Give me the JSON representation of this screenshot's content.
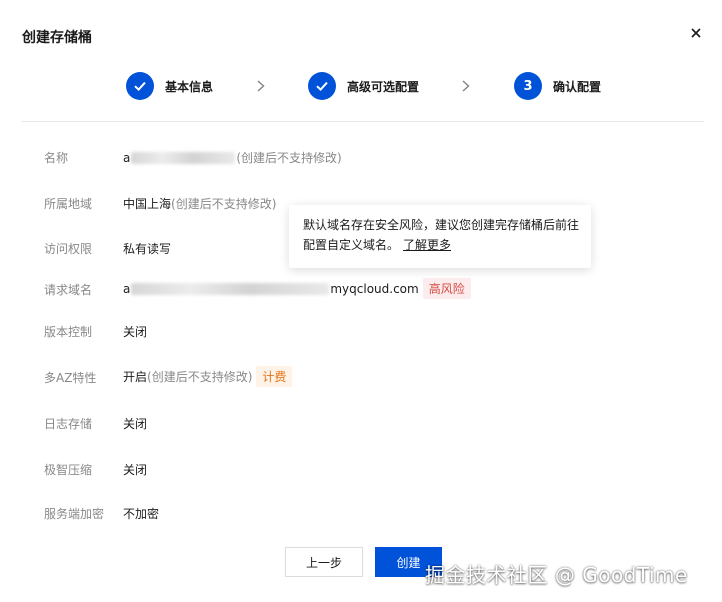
{
  "dialog": {
    "title": "创建存储桶"
  },
  "steps": [
    {
      "label": "基本信息",
      "status": "done"
    },
    {
      "label": "高级可选配置",
      "status": "done"
    },
    {
      "number": "3",
      "label": "确认配置",
      "status": "active"
    }
  ],
  "rows": {
    "name": {
      "label": "名称",
      "prefix": "a",
      "note": "(创建后不支持修改)"
    },
    "region": {
      "label": "所属地域",
      "value": "中国上海",
      "note": "(创建后不支持修改)"
    },
    "acl": {
      "label": "访问权限",
      "value": "私有读写"
    },
    "domain": {
      "label": "请求域名",
      "prefix": "a",
      "suffix": "myqcloud.com",
      "tag": "高风险"
    },
    "versioning": {
      "label": "版本控制",
      "value": "关闭"
    },
    "multi_az": {
      "label": "多AZ特性",
      "value": "开启",
      "note": "(创建后不支持修改)",
      "tag": "计费"
    },
    "logging": {
      "label": "日志存储",
      "value": "关闭"
    },
    "compression": {
      "label": "极智压缩",
      "value": "关闭"
    },
    "encryption": {
      "label": "服务端加密",
      "value": "不加密"
    }
  },
  "tooltip": {
    "text": "默认域名存在安全风险，建议您创建完存储桶后前往配置自定义域名。",
    "link": "了解更多"
  },
  "footer": {
    "prev_label": "上一步",
    "create_label": "创建"
  },
  "watermark": "掘金技术社区 @ GoodTime",
  "colors": {
    "primary": "#0052d9",
    "risk": "#d54941",
    "fee": "#e37318"
  }
}
